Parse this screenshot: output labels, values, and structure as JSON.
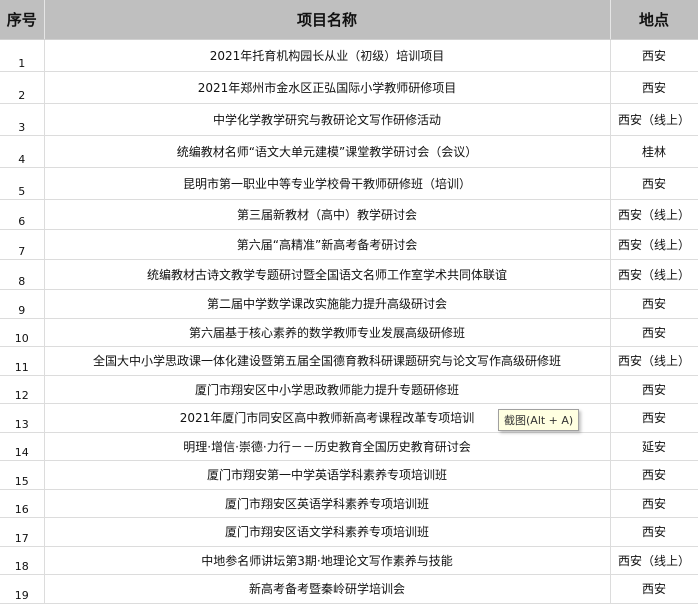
{
  "table": {
    "headers": {
      "num": "序号",
      "name": "项目名称",
      "location": "地点"
    },
    "rows": [
      {
        "num": "1",
        "name": "2021年托育机构园长从业（初级）培训项目",
        "location": "西安"
      },
      {
        "num": "2",
        "name": "2021年郑州市金水区正弘国际小学教师研修项目",
        "location": "西安"
      },
      {
        "num": "3",
        "name": "中学化学教学研究与教研论文写作研修活动",
        "location": "西安（线上）"
      },
      {
        "num": "4",
        "name": "统编教材名师“语文大单元建模”课堂教学研讨会（会议）",
        "location": "桂林"
      },
      {
        "num": "5",
        "name": "昆明市第一职业中等专业学校骨干教师研修班（培训）",
        "location": "西安"
      },
      {
        "num": "6",
        "name": "第三届新教材（高中）教学研讨会",
        "location": "西安（线上）"
      },
      {
        "num": "7",
        "name": "第六届“高精准”新高考备考研讨会",
        "location": "西安（线上）"
      },
      {
        "num": "8",
        "name": "统编教材古诗文教学专题研讨暨全国语文名师工作室学术共同体联谊",
        "location": "西安（线上）"
      },
      {
        "num": "9",
        "name": "第二届中学数学课改实施能力提升高级研讨会",
        "location": "西安"
      },
      {
        "num": "10",
        "name": "第六届基于核心素养的数学教师专业发展高级研修班",
        "location": "西安"
      },
      {
        "num": "11",
        "name": "全国大中小学思政课一体化建设暨第五届全国德育教科研课题研究与论文写作高级研修班",
        "location": "西安（线上）"
      },
      {
        "num": "12",
        "name": "厦门市翔安区中小学思政教师能力提升专题研修班",
        "location": "西安"
      },
      {
        "num": "13",
        "name": "2021年厦门市同安区高中教师新高考课程改革专项培训",
        "location": "西安"
      },
      {
        "num": "14",
        "name": "明理·增信·崇德·力行－－历史教育全国历史教育研讨会",
        "location": "延安"
      },
      {
        "num": "15",
        "name": "厦门市翔安第一中学英语学科素养专项培训班",
        "location": "西安"
      },
      {
        "num": "16",
        "name": "厦门市翔安区英语学科素养专项培训班",
        "location": "西安"
      },
      {
        "num": "17",
        "name": "厦门市翔安区语文学科素养专项培训班",
        "location": "西安"
      },
      {
        "num": "18",
        "name": "中地参名师讲坛第3期·地理论文写作素养与技能",
        "location": "西安（线上）"
      },
      {
        "num": "19",
        "name": "新高考备考暨秦岭研学培训会",
        "location": "西安"
      }
    ]
  },
  "tooltip": {
    "text": "截图(Alt + A)"
  }
}
